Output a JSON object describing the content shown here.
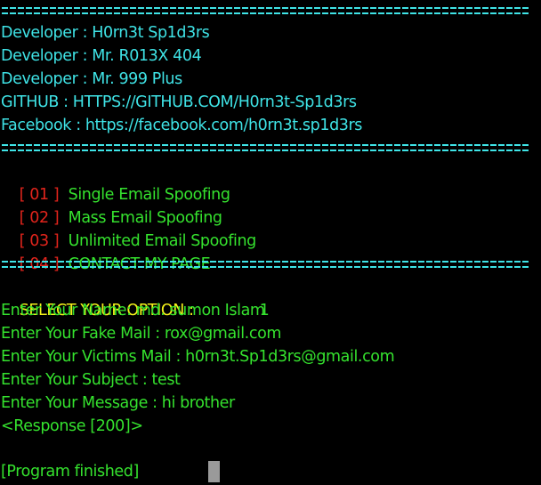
{
  "header": {
    "developers": [
      "Developer : H0rn3t Sp1d3rs",
      "Developer : Mr. R013X 404",
      "Developer : Mr. 999 Plus"
    ],
    "github": "GITHUB : HTTPS://GITHUB.COM/H0rn3t-Sp1d3rs",
    "facebook": "Facebook : https://facebook.com/h0rn3t.sp1d3rs"
  },
  "menu": {
    "items": [
      {
        "number": "[ 01 ]",
        "label": "Single Email Spoofing"
      },
      {
        "number": "[ 02 ]",
        "label": "Mass Email Spoofing"
      },
      {
        "number": "[ 03 ]",
        "label": "Unlimited Email Spoofing"
      },
      {
        "number": "[ 04 ]",
        "label": "CONTACT MY PAGE"
      }
    ]
  },
  "session": {
    "option_prompt": "SELECT YOUR OPTION :",
    "option_value": "1",
    "name_line": "Enter Your Name: md. sumon Islam",
    "fake_mail_line": "Enter Your Fake Mail : rox@gmail.com",
    "victim_mail_line": "Enter Your Victims Mail : h0rn3t.Sp1d3rs@gmail.com",
    "subject_line": "Enter Your Subject : test",
    "message_line": "Enter Your Message : hi brother",
    "response_line": "<Response [200]>",
    "finished_line": "[Program finished]"
  },
  "colors": {
    "background": "#000000",
    "cyan": "#3fe3e6",
    "green": "#35e22e",
    "red": "#e2241c",
    "yellow": "#f4f21a",
    "cursor": "#9a9a9a"
  }
}
